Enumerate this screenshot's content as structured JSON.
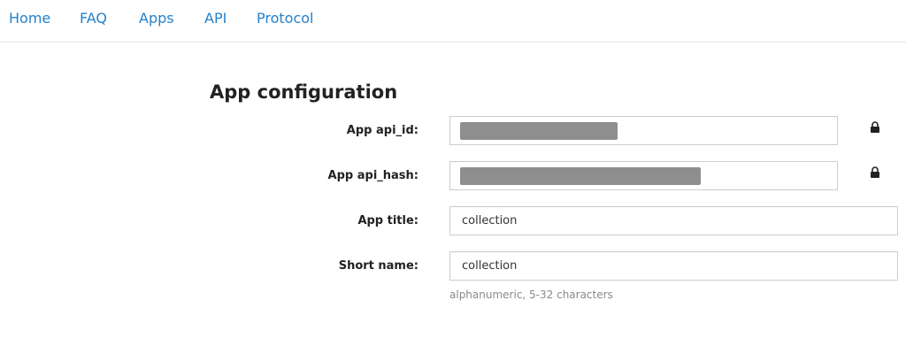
{
  "nav": {
    "items": [
      {
        "label": "Home"
      },
      {
        "label": "FAQ"
      },
      {
        "label": "Apps"
      },
      {
        "label": "API"
      },
      {
        "label": "Protocol"
      }
    ],
    "link_color": "#2481cc"
  },
  "page": {
    "title": "App configuration"
  },
  "fields": {
    "api_id": {
      "label": "App api_id:",
      "value_redacted": true,
      "icon": "lock-icon"
    },
    "api_hash": {
      "label": "App api_hash:",
      "value_redacted": true,
      "icon": "lock-icon"
    },
    "title": {
      "label": "App title:",
      "value": "collection"
    },
    "short_name": {
      "label": "Short name:",
      "value": "collection",
      "hint": "alphanumeric, 5-32 characters"
    }
  }
}
